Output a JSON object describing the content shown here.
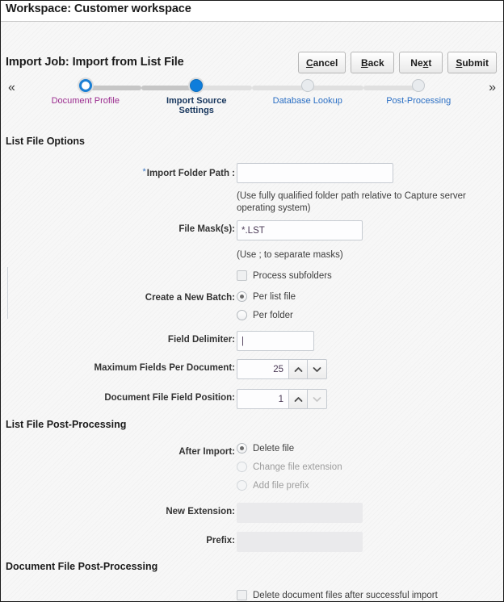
{
  "workspace": {
    "title": "Workspace: Customer workspace"
  },
  "job": {
    "title": "Import Job: Import from List File",
    "buttons": [
      {
        "name": "cancel-button",
        "pre": "",
        "accel": "C",
        "post": "ancel"
      },
      {
        "name": "back-button",
        "pre": "",
        "accel": "B",
        "post": "ack"
      },
      {
        "name": "next-button",
        "pre": "Ne",
        "accel": "x",
        "post": "t"
      },
      {
        "name": "submit-button",
        "pre": "",
        "accel": "S",
        "post": "ubmit"
      }
    ]
  },
  "train": {
    "prev_icon": "double-chevron-left-icon",
    "next_icon": "double-chevron-right-icon",
    "prev_glyph": "«",
    "next_glyph": "»",
    "steps": [
      {
        "label": "Document Profile",
        "state": "visited"
      },
      {
        "label": "Import Source\nSettings",
        "state": "current"
      },
      {
        "label": "Database Lookup",
        "state": "future"
      },
      {
        "label": "Post-Processing",
        "state": "future"
      }
    ]
  },
  "sections": {
    "list_file_options": "List File Options",
    "list_file_post_processing": "List File Post-Processing",
    "document_file_post_processing": "Document File Post-Processing"
  },
  "fields": {
    "import_folder_path": {
      "label": "Import Folder Path :",
      "required_marker": "*",
      "value": "",
      "hint": "(Use fully qualified folder path relative to Capture server operating system)"
    },
    "file_masks": {
      "label": "File Mask(s):",
      "value": "*.LST",
      "hint": "(Use ; to separate masks)"
    },
    "process_subfolders": {
      "label": "Process subfolders",
      "checked": false
    },
    "create_new_batch": {
      "label": "Create a New Batch:",
      "options": [
        {
          "label": "Per list file",
          "selected": true
        },
        {
          "label": "Per folder",
          "selected": false
        }
      ]
    },
    "field_delimiter": {
      "label": "Field Delimiter:",
      "value": "|"
    },
    "maximum_fields_per_document": {
      "label": "Maximum Fields Per Document:",
      "value": "25",
      "up_enabled": true,
      "down_enabled": true
    },
    "document_file_field_position": {
      "label": "Document File Field Position:",
      "value": "1",
      "up_enabled": true,
      "down_enabled": false
    },
    "after_import": {
      "label": "After Import:",
      "options": [
        {
          "label": "Delete file",
          "selected": true,
          "disabled": false
        },
        {
          "label": "Change file extension",
          "selected": false,
          "disabled": true
        },
        {
          "label": "Add file prefix",
          "selected": false,
          "disabled": true
        }
      ]
    },
    "new_extension": {
      "label": "New Extension:",
      "value": "",
      "disabled": true
    },
    "prefix": {
      "label": "Prefix:",
      "value": "",
      "disabled": true
    },
    "delete_document_files": {
      "label": "Delete document files after successful import",
      "checked": false
    }
  }
}
